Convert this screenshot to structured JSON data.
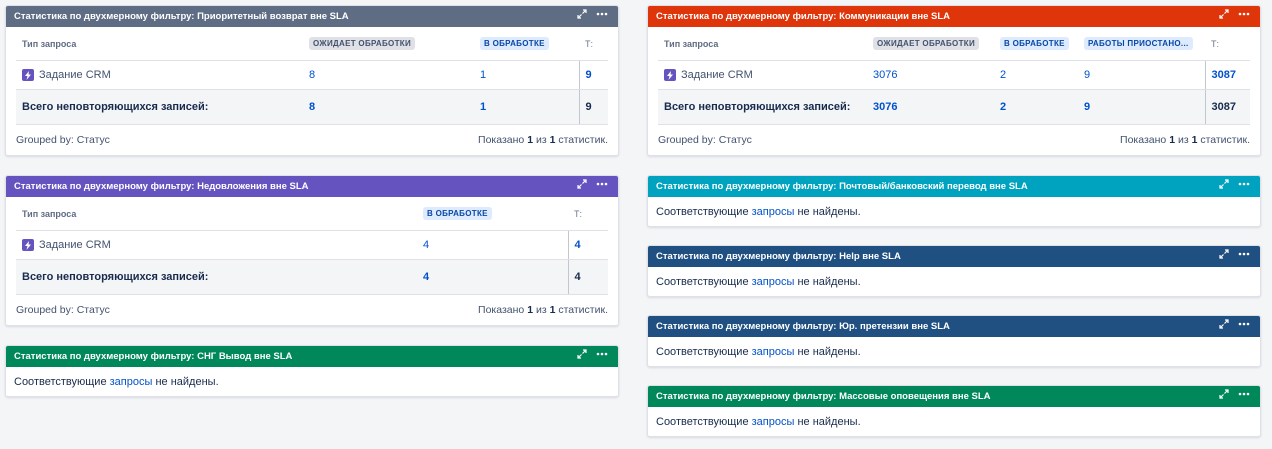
{
  "common": {
    "empty_prefix": "Соответствующие",
    "empty_link": "запросы",
    "empty_suffix": "не найдены.",
    "col_type": "Тип запроса",
    "col_total": "Т:",
    "row_type": "Задание CRM",
    "sum_label": "Всего неповторяющихся записей:",
    "grouped_by": "Grouped by: Статус",
    "shown_prefix": "Показано",
    "shown_mid": "из",
    "shown_suffix": "статистик.",
    "shown_cur": "1",
    "shown_total": "1"
  },
  "gadgets": {
    "g1": {
      "color": "#5e6c84",
      "title": "Статистика по двухмерному фильтру: Приоритетный возврат вне SLA",
      "col1": "ОЖИДАЕТ ОБРАБОТКИ",
      "col2": "В ОБРАБОТКЕ",
      "row": {
        "c1": "8",
        "c2": "1",
        "total": "9"
      },
      "sum": {
        "c1": "8",
        "c2": "1",
        "total": "9"
      }
    },
    "g2": {
      "color": "#6554c0",
      "title": "Статистика по двухмерному фильтру: Недовложения вне SLA",
      "col1": "В ОБРАБОТКЕ",
      "row": {
        "c1": "4",
        "total": "4"
      },
      "sum": {
        "c1": "4",
        "total": "4"
      }
    },
    "g3": {
      "color": "#00875a",
      "title": "Статистика по двухмерному фильтру: СНГ Вывод вне SLA"
    },
    "g4": {
      "color": "#de350b",
      "title": "Статистика по двухмерному фильтру: Коммуникации вне SLA",
      "col1": "ОЖИДАЕТ ОБРАБОТКИ",
      "col2": "В ОБРАБОТКЕ",
      "col3": "РАБОТЫ ПРИОСТАНО...",
      "row": {
        "c1": "3076",
        "c2": "2",
        "c3": "9",
        "total": "3087"
      },
      "sum": {
        "c1": "3076",
        "c2": "2",
        "c3": "9",
        "total": "3087"
      }
    },
    "g5": {
      "color": "#00a3bf",
      "title": "Статистика по двухмерному фильтру: Почтовый/банковский перевод вне SLA"
    },
    "g6": {
      "color": "#205081",
      "title": "Статистика по двухмерному фильтру: Help вне SLA"
    },
    "g7": {
      "color": "#205081",
      "title": "Статистика по двухмерному фильтру: Юр. претензии вне SLA"
    },
    "g8": {
      "color": "#00875a",
      "title": "Статистика по двухмерному фильтру: Массовые оповещения вне SLA"
    }
  }
}
